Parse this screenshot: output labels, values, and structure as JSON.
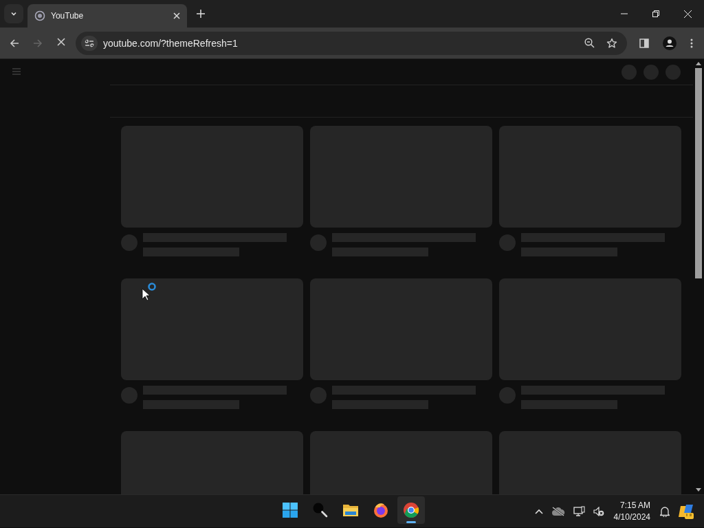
{
  "browser": {
    "tabs": [
      {
        "title": "YouTube",
        "selected": true
      }
    ],
    "address": "youtube.com/?themeRefresh=1",
    "loading": true
  },
  "page": {
    "cards": [
      {
        "kind": "skeleton"
      },
      {
        "kind": "skeleton"
      },
      {
        "kind": "skeleton"
      },
      {
        "kind": "skeleton"
      },
      {
        "kind": "skeleton"
      },
      {
        "kind": "skeleton"
      },
      {
        "kind": "thumbnail_only"
      },
      {
        "kind": "thumbnail_only"
      },
      {
        "kind": "thumbnail_only"
      }
    ]
  },
  "taskbar": {
    "apps": [
      {
        "kind": "start",
        "selected": false
      },
      {
        "kind": "search",
        "selected": false
      },
      {
        "kind": "files",
        "selected": false
      },
      {
        "kind": "firefox",
        "selected": false
      },
      {
        "kind": "chrome",
        "selected": true
      }
    ],
    "time": "7:15 AM",
    "date": "4/10/2024"
  }
}
